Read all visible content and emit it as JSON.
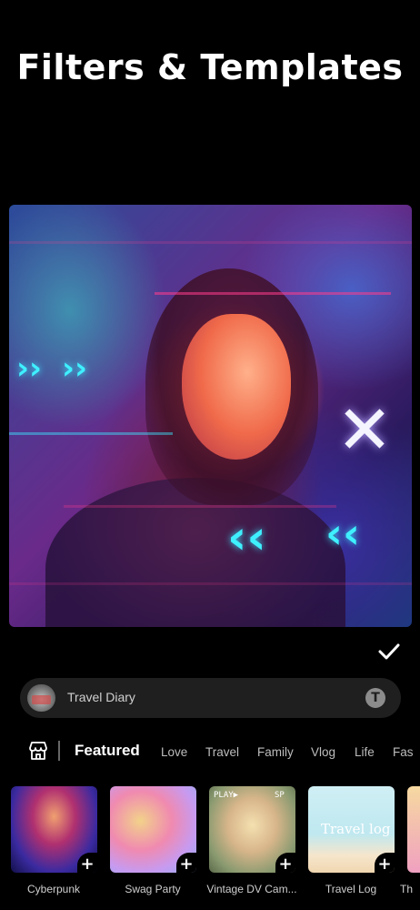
{
  "header": {
    "title": "Filters & Templates"
  },
  "preview": {
    "image": "glitch-portrait-preview"
  },
  "actions": {
    "apply_icon": "checkmark-icon"
  },
  "template_bar": {
    "label": "Travel Diary",
    "text_button_icon": "text-icon",
    "thumb_icon": "template-thumbnail"
  },
  "tabs": {
    "store_icon": "store-icon",
    "items": [
      "Featured",
      "Love",
      "Travel",
      "Family",
      "Vlog",
      "Life",
      "Fas"
    ],
    "active": "Featured"
  },
  "templates": [
    {
      "label": "Cyberpunk"
    },
    {
      "label": "Swag Party"
    },
    {
      "label": "Vintage DV Cam..."
    },
    {
      "label": "Travel Log",
      "overlay": "Travel log"
    },
    {
      "label": "Th"
    }
  ],
  "vintage_overlay": {
    "left": "PLAY▶",
    "right": "SP"
  },
  "colors": {
    "background": "#000000",
    "bar": "#1f1f1f",
    "accent_cyan": "#3ff0ff"
  }
}
